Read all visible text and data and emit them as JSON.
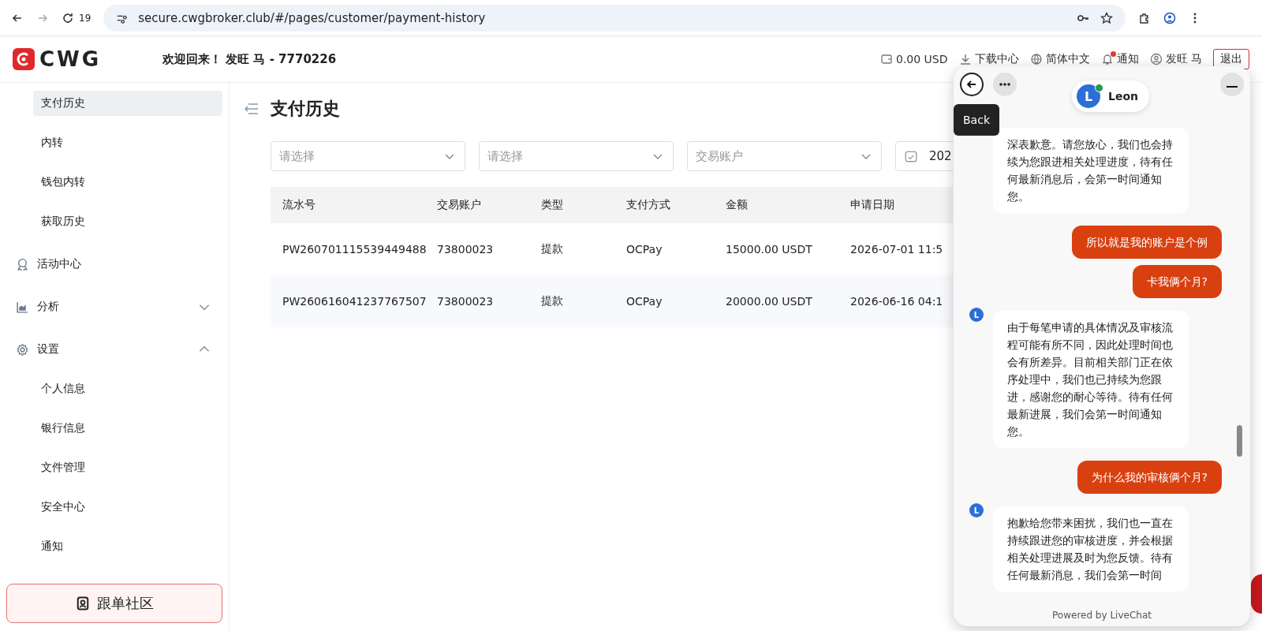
{
  "browser": {
    "tab_count": "19",
    "url": "secure.cwgbroker.club/#/pages/customer/payment-history"
  },
  "header": {
    "logo": "CWG",
    "welcome": "欢迎回来！ 发旺 马 - 7770226",
    "balance": "0.00 USD",
    "download": "下载中心",
    "language": "简体中文",
    "notifications": "通知",
    "has_unread": true,
    "user": "发旺 马",
    "logout": "退出"
  },
  "sidebar": {
    "items": [
      {
        "label": "支付历史",
        "kind": "sub",
        "selected": true
      },
      {
        "label": "内转",
        "kind": "sub",
        "selected": false
      },
      {
        "label": "钱包内转",
        "kind": "sub",
        "selected": false
      },
      {
        "label": "获取历史",
        "kind": "sub",
        "selected": false
      },
      {
        "label": "活动中心",
        "kind": "section",
        "selected": false
      },
      {
        "label": "分析",
        "kind": "section",
        "selected": false,
        "expanded": false
      },
      {
        "label": "设置",
        "kind": "section",
        "selected": false,
        "expanded": true
      },
      {
        "label": "个人信息",
        "kind": "sub",
        "selected": false
      },
      {
        "label": "银行信息",
        "kind": "sub",
        "selected": false
      },
      {
        "label": "文件管理",
        "kind": "sub",
        "selected": false
      },
      {
        "label": "安全中心",
        "kind": "sub",
        "selected": false
      },
      {
        "label": "通知",
        "kind": "sub",
        "selected": false
      }
    ],
    "community_button": "跟单社区"
  },
  "page": {
    "title": "支付历史",
    "filters": [
      {
        "kind": "select",
        "placeholder": "请选择"
      },
      {
        "kind": "select",
        "placeholder": "请选择"
      },
      {
        "kind": "select",
        "placeholder": "交易账户"
      },
      {
        "kind": "date",
        "value": "202"
      }
    ]
  },
  "table": {
    "columns": [
      "流水号",
      "交易账户",
      "类型",
      "支付方式",
      "金额",
      "申请日期"
    ],
    "rows": [
      [
        "PW260701115539449488",
        "73800023",
        "提款",
        "OCPay",
        "15000.00 USDT",
        "2026-07-01 11:5"
      ],
      [
        "PW260616041237767507",
        "73800023",
        "提款",
        "OCPay",
        "20000.00 USDT",
        "2026-06-16 04:1"
      ]
    ]
  },
  "chat": {
    "agent": "Leon",
    "avatar_letter": "L",
    "online": true,
    "tooltip": "Back",
    "footer": "Powered by LiveChat",
    "messages": [
      {
        "kind": "agent",
        "text": "深表歉意。请您放心，我们也会持续为您跟进相关处理进度，待有任何最新消息后，会第一时间通知您。"
      },
      {
        "kind": "user",
        "text": "所以就是我的账户是个例"
      },
      {
        "kind": "user",
        "text": "卡我俩个月?"
      },
      {
        "kind": "agent",
        "avatar": "L",
        "text": "由于每笔申请的具体情况及审核流程可能有所不同，因此处理时间也会有所差异。目前相关部门正在依序处理中，我们也已持续为您跟进，感谢您的耐心等待。待有任何最新进展，我们会第一时间通知您。"
      },
      {
        "kind": "user",
        "text": "为什么我的审核俩个月?"
      },
      {
        "kind": "agent",
        "avatar": "L",
        "text": "抱歉给您带来困扰，我们也一直在持续跟进您的审核进度，并会根据相关处理进展及时为您反馈。待有任何最新消息，我们会第一时间"
      }
    ]
  }
}
